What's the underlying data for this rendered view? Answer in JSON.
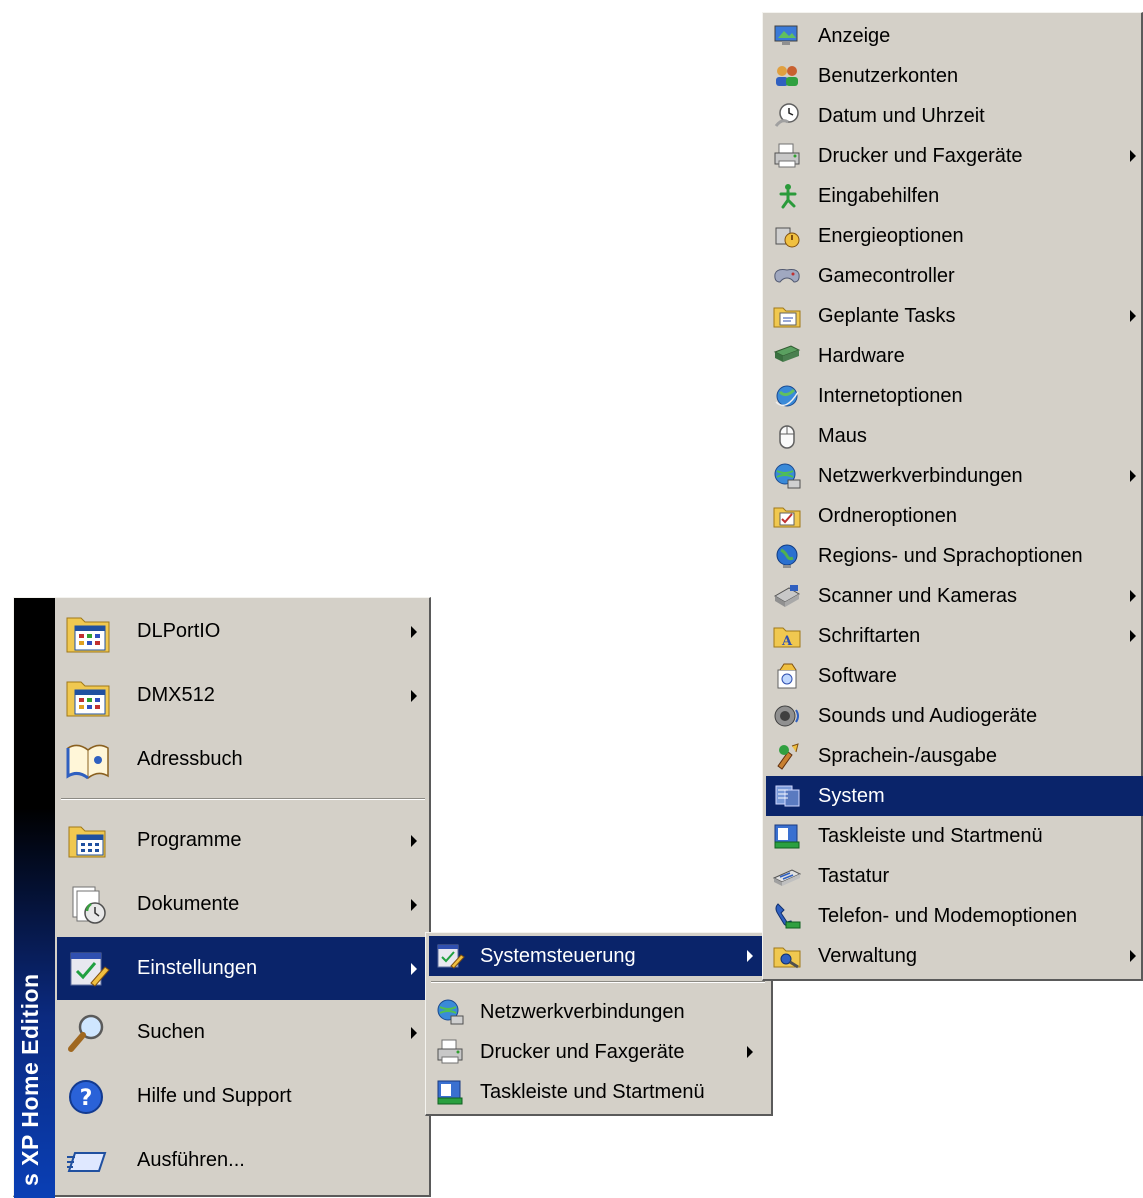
{
  "start_menu": {
    "banner": "s XP Home Edition",
    "items": [
      {
        "label": "DLPortIO",
        "arrow": true,
        "icon": "program-folder-icon"
      },
      {
        "label": "DMX512",
        "arrow": true,
        "icon": "program-folder-icon"
      },
      {
        "label": "Adressbuch",
        "arrow": false,
        "icon": "address-book-icon"
      },
      {
        "label": "Programme",
        "arrow": true,
        "icon": "programs-icon"
      },
      {
        "label": "Dokumente",
        "arrow": true,
        "icon": "documents-icon"
      },
      {
        "label": "Einstellungen",
        "arrow": true,
        "icon": "settings-icon",
        "highlighted": true
      },
      {
        "label": "Suchen",
        "arrow": true,
        "icon": "search-icon"
      },
      {
        "label": "Hilfe und Support",
        "arrow": false,
        "icon": "help-icon"
      },
      {
        "label": "Ausführen...",
        "arrow": false,
        "icon": "run-icon"
      }
    ]
  },
  "settings_menu": {
    "items": [
      {
        "label": "Systemsteuerung",
        "arrow": true,
        "icon": "control-panel-icon",
        "highlighted": true
      },
      {
        "label": "Netzwerkverbindungen",
        "arrow": false,
        "icon": "network-icon"
      },
      {
        "label": "Drucker und Faxgeräte",
        "arrow": true,
        "icon": "printer-icon"
      },
      {
        "label": "Taskleiste und Startmenü",
        "arrow": false,
        "icon": "taskbar-icon"
      }
    ]
  },
  "control_panel_menu": {
    "items": [
      {
        "label": "Anzeige",
        "arrow": false,
        "icon": "display-icon"
      },
      {
        "label": "Benutzerkonten",
        "arrow": false,
        "icon": "user-accounts-icon"
      },
      {
        "label": "Datum und Uhrzeit",
        "arrow": false,
        "icon": "clock-icon"
      },
      {
        "label": "Drucker und Faxgeräte",
        "arrow": true,
        "icon": "printer-icon"
      },
      {
        "label": "Eingabehilfen",
        "arrow": false,
        "icon": "accessibility-icon"
      },
      {
        "label": "Energieoptionen",
        "arrow": false,
        "icon": "power-icon"
      },
      {
        "label": "Gamecontroller",
        "arrow": false,
        "icon": "gamepad-icon"
      },
      {
        "label": "Geplante Tasks",
        "arrow": true,
        "icon": "scheduled-tasks-icon"
      },
      {
        "label": "Hardware",
        "arrow": false,
        "icon": "hardware-icon"
      },
      {
        "label": "Internetoptionen",
        "arrow": false,
        "icon": "internet-icon"
      },
      {
        "label": "Maus",
        "arrow": false,
        "icon": "mouse-icon"
      },
      {
        "label": "Netzwerkverbindungen",
        "arrow": true,
        "icon": "network-icon"
      },
      {
        "label": "Ordneroptionen",
        "arrow": false,
        "icon": "folder-options-icon"
      },
      {
        "label": "Regions- und Sprachoptionen",
        "arrow": false,
        "icon": "globe-icon"
      },
      {
        "label": "Scanner und Kameras",
        "arrow": true,
        "icon": "scanner-icon"
      },
      {
        "label": "Schriftarten",
        "arrow": true,
        "icon": "fonts-icon"
      },
      {
        "label": "Software",
        "arrow": false,
        "icon": "software-icon"
      },
      {
        "label": "Sounds und Audiogeräte",
        "arrow": false,
        "icon": "speaker-icon"
      },
      {
        "label": "Sprachein-/ausgabe",
        "arrow": false,
        "icon": "speech-icon"
      },
      {
        "label": "System",
        "arrow": false,
        "icon": "system-icon",
        "highlighted": true
      },
      {
        "label": "Taskleiste und Startmenü",
        "arrow": false,
        "icon": "taskbar-icon"
      },
      {
        "label": "Tastatur",
        "arrow": false,
        "icon": "keyboard-icon"
      },
      {
        "label": "Telefon- und Modemoptionen",
        "arrow": false,
        "icon": "phone-icon"
      },
      {
        "label": "Verwaltung",
        "arrow": true,
        "icon": "admin-tools-icon"
      }
    ]
  },
  "colors": {
    "menu_bg": "#d4d0c8",
    "highlight": "#0a246a",
    "highlight_text": "#ffffff",
    "banner_dark": "#000000",
    "banner_blue": "#0a3fb5"
  }
}
